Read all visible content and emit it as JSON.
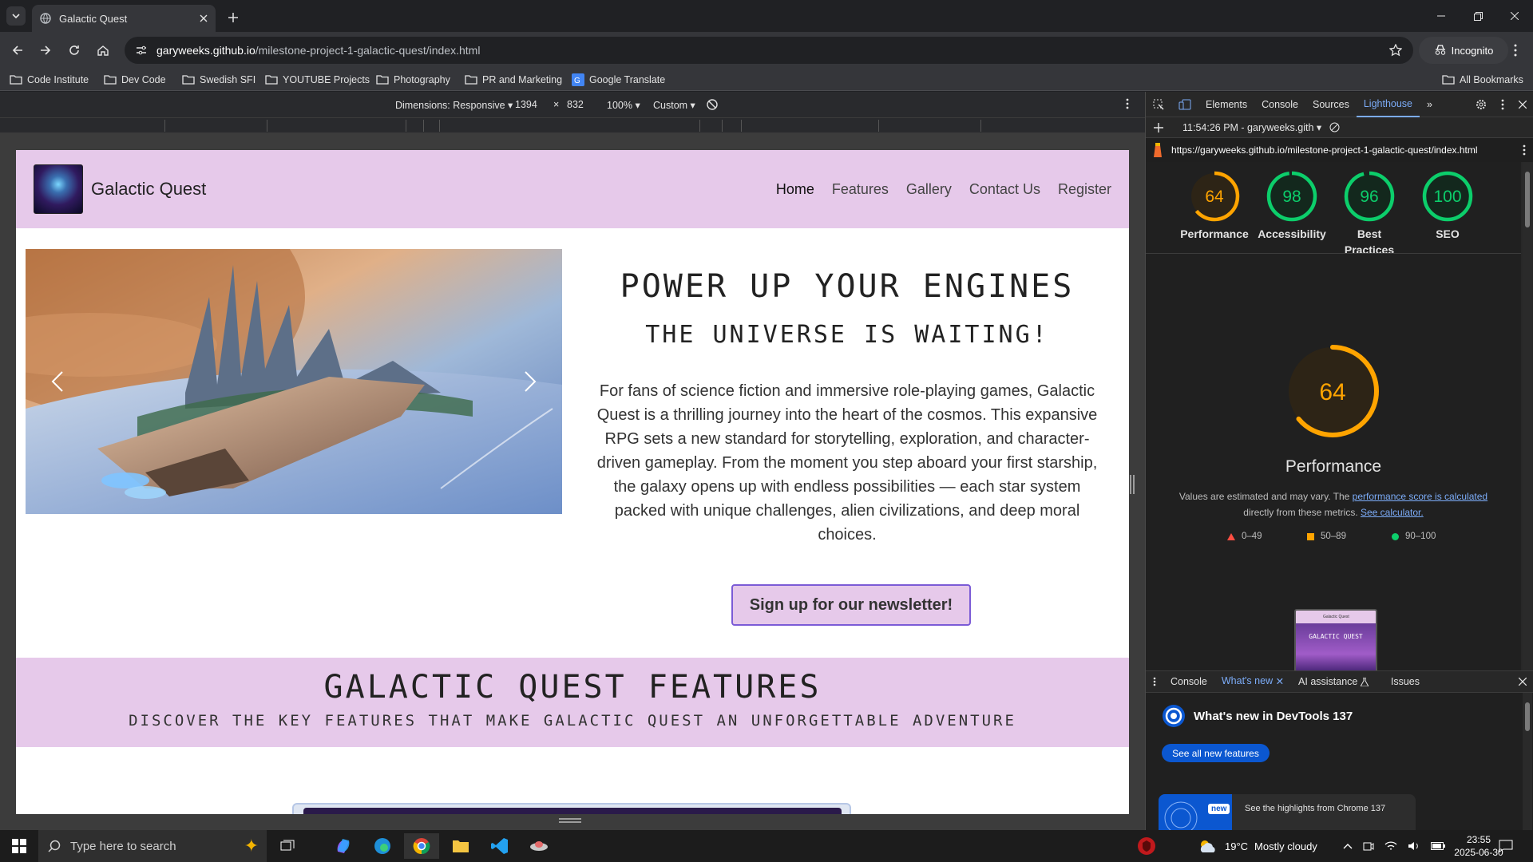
{
  "browser": {
    "tab_title": "Galactic Quest",
    "url_host": "garyweeks.github.io",
    "url_path": "/milestone-project-1-galactic-quest/index.html",
    "incognito_label": "Incognito",
    "bookmarks": [
      "Code Institute",
      "Dev Code",
      "Swedish SFI",
      "YOUTUBE Projects",
      "Photography",
      "PR and Marketing",
      "Google Translate"
    ],
    "all_bookmarks": "All Bookmarks"
  },
  "emulation": {
    "dimensions_label": "Dimensions: Responsive",
    "width": "1394",
    "times": "×",
    "height": "832",
    "zoom": "100%",
    "throttle": "Custom"
  },
  "page": {
    "brand": "Galactic Quest",
    "nav": [
      "Home",
      "Features",
      "Gallery",
      "Contact Us",
      "Register"
    ],
    "hero_title": "POWER UP YOUR ENGINES",
    "hero_subtitle": "THE UNIVERSE IS WAITING!",
    "hero_paragraph": "For fans of science fiction and immersive role-playing games, Galactic Quest is a thrilling journey into the heart of the cosmos. This expansive RPG sets a new standard for storytelling, exploration, and character-driven gameplay. From the moment you step aboard your first starship, the galaxy opens up with endless possibilities — each star system packed with unique challenges, alien civilizations, and deep moral choices.",
    "signup_button": "Sign up for our newsletter!",
    "features_title": "GALACTIC QUEST FEATURES",
    "features_subtitle": "DISCOVER THE KEY FEATURES THAT MAKE GALACTIC QUEST AN UNFORGETTABLE ADVENTURE"
  },
  "devtools": {
    "tabs": [
      "Elements",
      "Console",
      "Sources",
      "Lighthouse"
    ],
    "active_tab": "Lighthouse",
    "report_time": "11:54:26 PM - garyweeks.gith",
    "report_url": "https://garyweeks.github.io/milestone-project-1-galactic-quest/index.html",
    "scores": [
      {
        "label": "Performance",
        "value": 64,
        "color": "#ffa400"
      },
      {
        "label": "Accessibility",
        "value": 98,
        "color": "#0cce6b"
      },
      {
        "label": "Best Practices",
        "value": 96,
        "color": "#0cce6b"
      },
      {
        "label": "SEO",
        "value": 100,
        "color": "#0cce6b"
      }
    ],
    "perf_big_value": "64",
    "perf_title": "Performance",
    "perf_note_prefix": "Values are estimated and may vary. The ",
    "perf_note_link1": "performance score is calculated",
    "perf_note_mid": " directly from these metrics. ",
    "perf_note_link2": "See calculator.",
    "legend": [
      "0–49",
      "50–89",
      "90–100"
    ],
    "thumb_title": "GALACTIC QUEST",
    "thumb_brand": "Galactic Quest",
    "drawer_tabs": [
      "Console",
      "What's new",
      "AI assistance",
      "Issues"
    ],
    "whats_new_title": "What's new in DevTools 137",
    "see_all": "See all new features",
    "new_badge": "new",
    "highlights": "See the highlights from Chrome 137"
  },
  "taskbar": {
    "search_placeholder": "Type here to search",
    "temperature": "19°C",
    "weather": "Mostly cloudy",
    "time": "23:55",
    "date": "2025-06-30"
  }
}
